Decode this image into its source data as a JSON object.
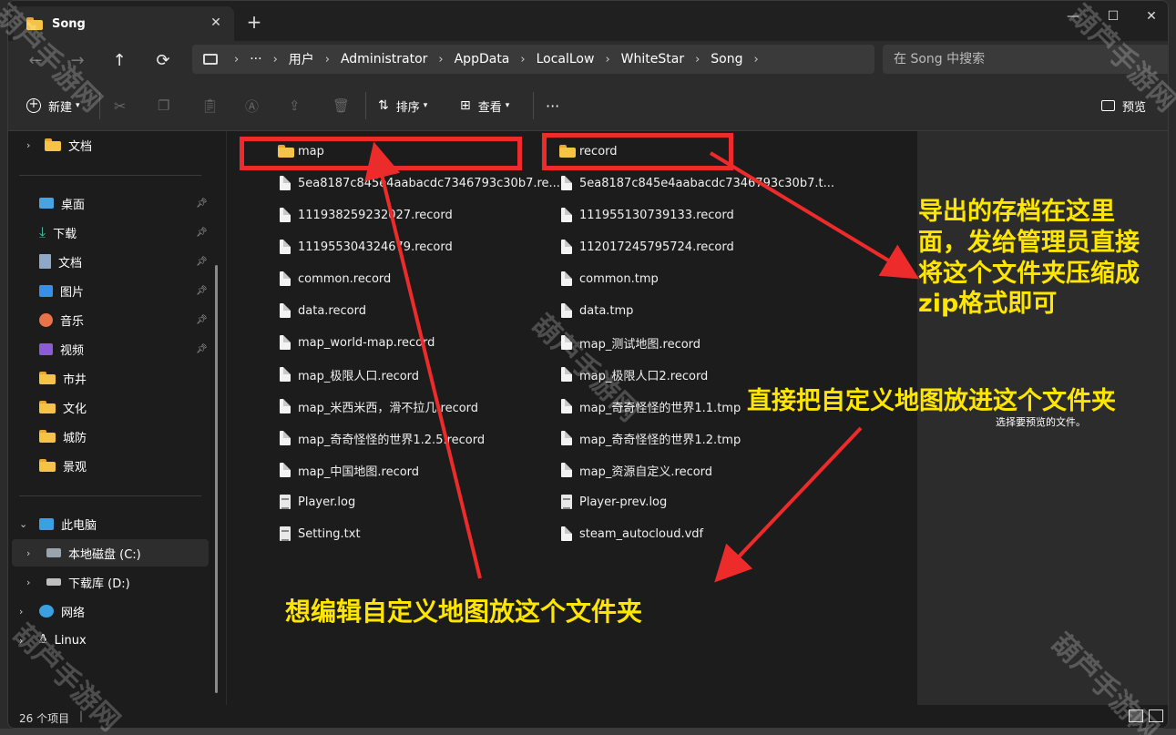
{
  "window": {
    "tab_title": "Song",
    "tab_close": "✕",
    "new_tab": "+",
    "minimize": "—",
    "maximize": "☐",
    "close": "✕"
  },
  "nav": {
    "back": "←",
    "forward": "→",
    "up": "↑",
    "refresh": "⟳"
  },
  "breadcrumb": {
    "overflow": "···",
    "items": [
      "用户",
      "Administrator",
      "AppData",
      "LocalLow",
      "WhiteStar",
      "Song"
    ]
  },
  "search": {
    "placeholder": "在 Song 中搜索"
  },
  "toolbar": {
    "new_label": "新建",
    "sort_label": "排序",
    "view_label": "查看",
    "more": "···",
    "preview_label": "预览"
  },
  "sidebar": {
    "top_item": "文档",
    "quick_access": [
      "桌面",
      "下载",
      "文档",
      "图片",
      "音乐",
      "视频",
      "市井",
      "文化",
      "城防",
      "景观"
    ],
    "this_pc": "此电脑",
    "drive_c": "本地磁盘 (C:)",
    "drive_d": "下载库 (D:)",
    "network": "网络",
    "linux": "Linux"
  },
  "files": {
    "col1": [
      {
        "name": "map",
        "type": "folder"
      },
      {
        "name": "5ea8187c845e4aabacdc7346793c30b7.re...",
        "type": "file"
      },
      {
        "name": "111938259232027.record",
        "type": "file"
      },
      {
        "name": "111955304324679.record",
        "type": "file"
      },
      {
        "name": "common.record",
        "type": "file"
      },
      {
        "name": "data.record",
        "type": "file"
      },
      {
        "name": "map_world-map.record",
        "type": "file"
      },
      {
        "name": "map_极限人口.record",
        "type": "file"
      },
      {
        "name": "map_米西米西，滑不拉几.record",
        "type": "file"
      },
      {
        "name": "map_奇奇怪怪的世界1.2.5.record",
        "type": "file"
      },
      {
        "name": "map_中国地图.record",
        "type": "file"
      },
      {
        "name": "Player.log",
        "type": "log"
      },
      {
        "name": "Setting.txt",
        "type": "log"
      }
    ],
    "col2": [
      {
        "name": "record",
        "type": "folder"
      },
      {
        "name": "5ea8187c845e4aabacdc7346793c30b7.t...",
        "type": "file"
      },
      {
        "name": "111955130739133.record",
        "type": "file"
      },
      {
        "name": "112017245795724.record",
        "type": "file"
      },
      {
        "name": "common.tmp",
        "type": "file"
      },
      {
        "name": "data.tmp",
        "type": "file"
      },
      {
        "name": "map_测试地图.record",
        "type": "file"
      },
      {
        "name": "map_极限人口2.record",
        "type": "file"
      },
      {
        "name": "map_奇奇怪怪的世界1.1.tmp",
        "type": "file"
      },
      {
        "name": "map_奇奇怪怪的世界1.2.tmp",
        "type": "file"
      },
      {
        "name": "map_资源自定义.record",
        "type": "file"
      },
      {
        "name": "Player-prev.log",
        "type": "log"
      },
      {
        "name": "steam_autocloud.vdf",
        "type": "file"
      }
    ]
  },
  "preview": {
    "empty_text": "选择要预览的文件。"
  },
  "status": {
    "count": "26 个项目"
  },
  "annotations": {
    "export_note": [
      "导出的存档在这里",
      "面，发给管理员直接",
      "将这个文件夹压缩成",
      "zip格式即可"
    ],
    "custom_map_note": "直接把自定义地图放进这个文件夹",
    "edit_map_note": "想编辑自定义地图放这个文件夹",
    "arrow_color": "#ee2b2b",
    "text_color": "#ffe600"
  },
  "watermark": "葫芦手游网"
}
